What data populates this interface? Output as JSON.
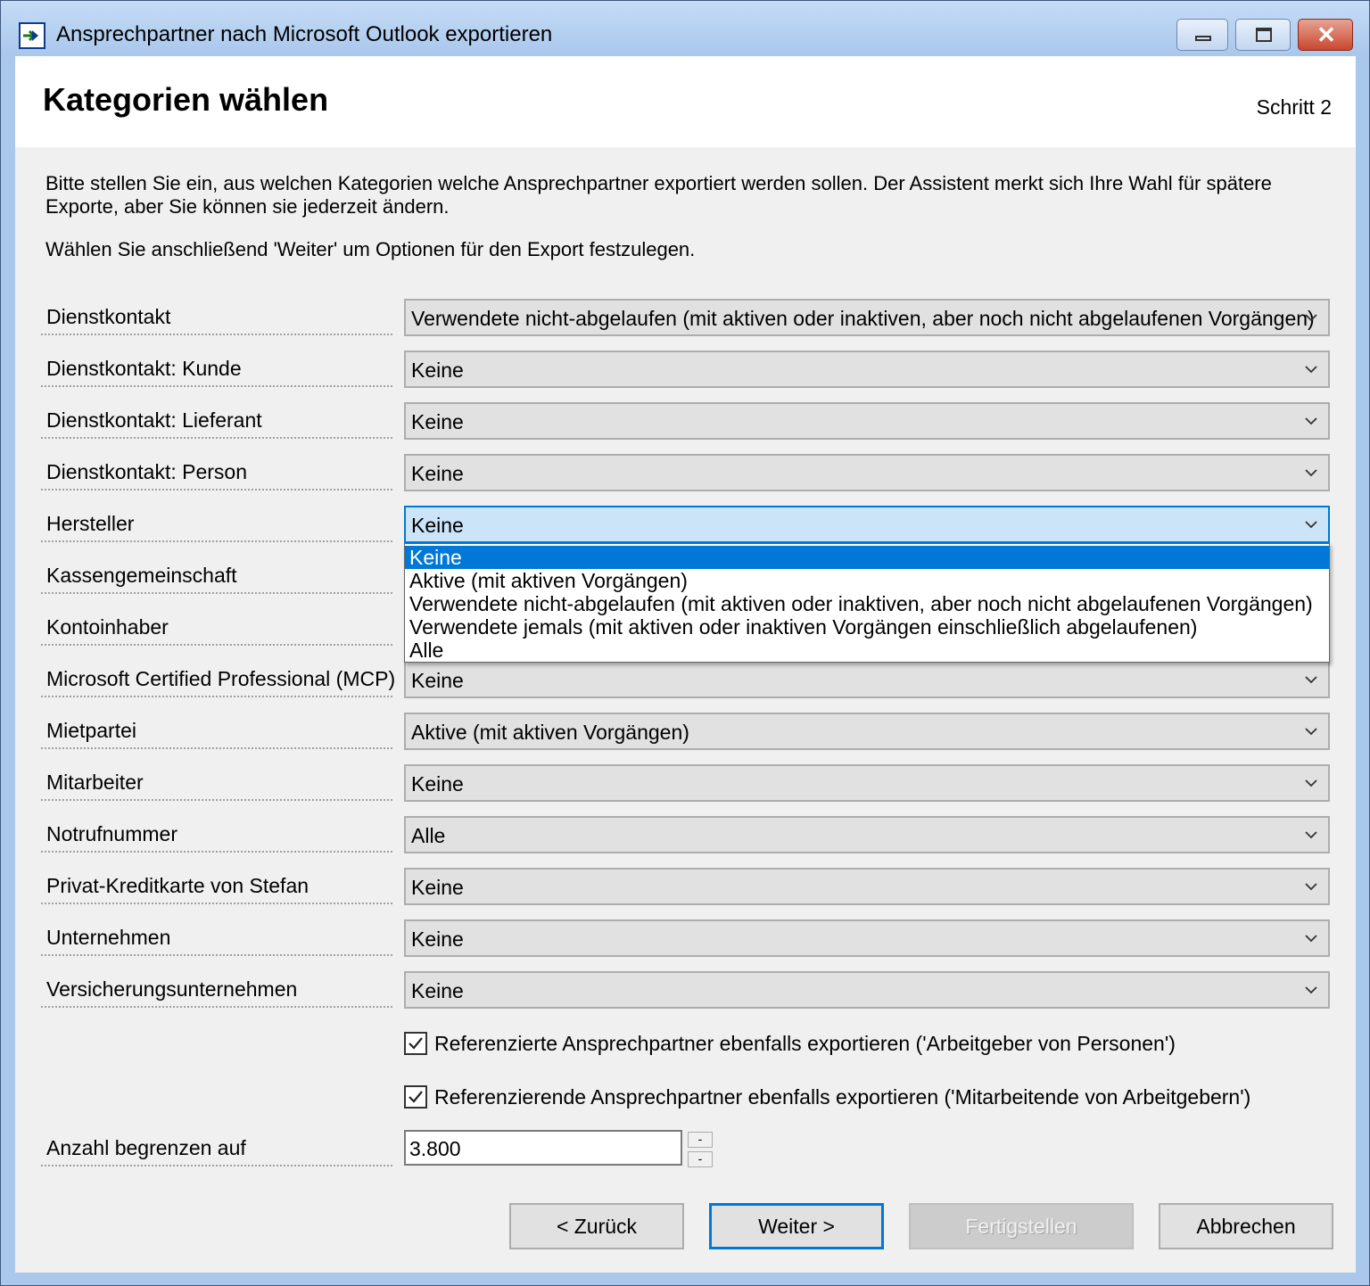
{
  "window": {
    "title": "Ansprechpartner nach Microsoft Outlook exportieren",
    "icon": "export-arrow-icon",
    "controls": {
      "minimize": "minimize-icon",
      "maximize": "maximize-icon",
      "close": "close-icon"
    }
  },
  "header": {
    "title": "Kategorien wählen",
    "step": "Schritt 2"
  },
  "intro": {
    "paragraph1": "Bitte stellen Sie ein, aus welchen Kategorien welche Ansprechpartner exportiert werden sollen. Der Assistent merkt sich Ihre Wahl für spätere Exporte, aber Sie können sie jederzeit ändern.",
    "paragraph2": "Wählen Sie anschließend 'Weiter' um Optionen für den Export festzulegen."
  },
  "categories": [
    {
      "label": "Dienstkontakt",
      "value": "Verwendete nicht-abgelaufen (mit aktiven oder inaktiven, aber noch nicht abgelaufenen Vorgängen)"
    },
    {
      "label": "Dienstkontakt: Kunde",
      "value": "Keine"
    },
    {
      "label": "Dienstkontakt: Lieferant",
      "value": "Keine"
    },
    {
      "label": "Dienstkontakt: Person",
      "value": "Keine"
    },
    {
      "label": "Hersteller",
      "value": "Keine"
    },
    {
      "label": "Kassengemeinschaft",
      "value": ""
    },
    {
      "label": "Kontoinhaber",
      "value": ""
    },
    {
      "label": "Microsoft Certified Professional (MCP)",
      "value": "Keine"
    },
    {
      "label": "Mietpartei",
      "value": "Aktive (mit aktiven Vorgängen)"
    },
    {
      "label": "Mitarbeiter",
      "value": "Keine"
    },
    {
      "label": "Notrufnummer",
      "value": "Alle"
    },
    {
      "label": "Privat-Kreditkarte von Stefan",
      "value": "Keine"
    },
    {
      "label": "Unternehmen",
      "value": "Keine"
    },
    {
      "label": "Versicherungsunternehmen",
      "value": "Keine"
    }
  ],
  "dropdown": {
    "open_for": "Hersteller",
    "selected_index": 0,
    "options": [
      "Keine",
      "Aktive (mit aktiven Vorgängen)",
      "Verwendete nicht-abgelaufen (mit aktiven oder inaktiven, aber noch nicht abgelaufenen Vorgängen)",
      "Verwendete jemals (mit aktiven oder inaktiven Vorgängen einschließlich abgelaufenen)",
      "Alle"
    ]
  },
  "options": {
    "referenced": {
      "label": "Referenzierte Ansprechpartner ebenfalls exportieren ('Arbeitgeber von Personen')",
      "checked": true
    },
    "referencing": {
      "label": "Referenzierende Ansprechpartner ebenfalls exportieren ('Mitarbeitende von Arbeitgebern')",
      "checked": true
    }
  },
  "limit": {
    "label": "Anzahl begrenzen auf",
    "value": "3.800",
    "up": "-",
    "down": "-"
  },
  "buttons": {
    "back": "< Zurück",
    "next": "Weiter >",
    "finish": "Fertigstellen",
    "cancel": "Abbrechen"
  },
  "colors": {
    "accent": "#0078d7",
    "selection": "#0078d7",
    "active_combo": "#cce4f7",
    "title_bar": "#aac8ec",
    "close_button": "#c9472f"
  }
}
